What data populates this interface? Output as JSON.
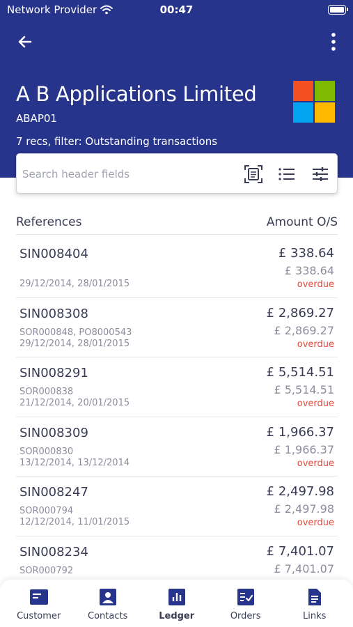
{
  "status_bar": {
    "carrier": "Network Provider",
    "time": "00:47"
  },
  "header": {
    "back_icon": "back-arrow-icon",
    "more_icon": "more-vertical-icon",
    "company_name": "A B Applications Limited",
    "company_code": "ABAP01",
    "filter_summary": "7 recs, filter: Outstanding transactions",
    "logo_colors": [
      "#f25022",
      "#7fba00",
      "#00a4ef",
      "#ffb900"
    ],
    "brand_color": "#27348b"
  },
  "search": {
    "placeholder": "Search header fields",
    "value": "",
    "icons": [
      "scan-document-icon",
      "list-icon",
      "filter-sliders-icon"
    ]
  },
  "columns": {
    "left": "References",
    "right": "Amount O/S"
  },
  "rows": [
    {
      "ref": "SIN008404",
      "sub": "",
      "dates": "29/12/2014, 28/01/2015",
      "amount": "£ 338.64",
      "amount_os": "£ 338.64",
      "status": "overdue"
    },
    {
      "ref": "SIN008308",
      "sub": "SOR000848, PO8000543",
      "dates": "29/12/2014, 28/01/2015",
      "amount": "£ 2,869.27",
      "amount_os": "£ 2,869.27",
      "status": "overdue"
    },
    {
      "ref": "SIN008291",
      "sub": "SOR000838",
      "dates": "21/12/2014, 20/01/2015",
      "amount": "£ 5,514.51",
      "amount_os": "£ 5,514.51",
      "status": "overdue"
    },
    {
      "ref": "SIN008309",
      "sub": "SOR000830",
      "dates": "13/12/2014, 13/12/2014",
      "amount": "£ 1,966.37",
      "amount_os": "£ 1,966.37",
      "status": "overdue"
    },
    {
      "ref": "SIN008247",
      "sub": "SOR000794",
      "dates": "12/12/2014, 11/01/2015",
      "amount": "£ 2,497.98",
      "amount_os": "£ 2,497.98",
      "status": "overdue"
    },
    {
      "ref": "SIN008234",
      "sub": "SOR000792",
      "dates": "",
      "amount": "£ 7,401.07",
      "amount_os": "£ 7,401.07",
      "status": ""
    }
  ],
  "tabs": [
    {
      "label": "Customer",
      "icon": "customer-card-icon",
      "active": false
    },
    {
      "label": "Contacts",
      "icon": "contacts-icon",
      "active": false
    },
    {
      "label": "Ledger",
      "icon": "ledger-chart-icon",
      "active": true
    },
    {
      "label": "Orders",
      "icon": "orders-checklist-icon",
      "active": false
    },
    {
      "label": "Links",
      "icon": "links-document-icon",
      "active": false
    }
  ]
}
